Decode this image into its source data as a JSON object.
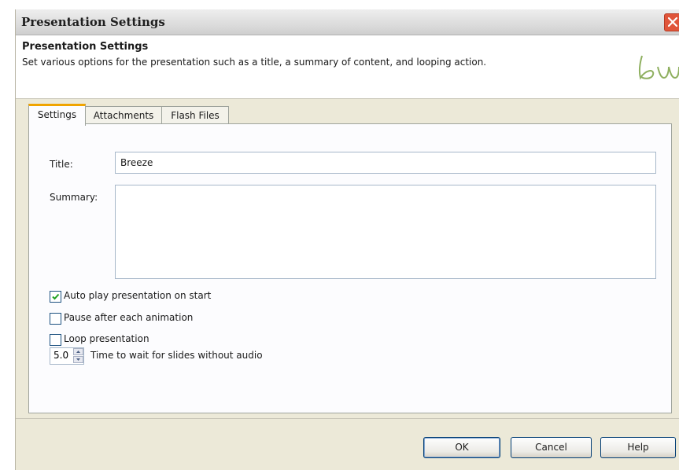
{
  "window": {
    "title": "Presentation Settings"
  },
  "header": {
    "title": "Presentation Settings",
    "subtitle": "Set various options for the presentation such as a title, a summary of content, and looping action.",
    "logo_icon": "breeze-logo-icon"
  },
  "tabs": [
    {
      "label": "Settings",
      "active": true
    },
    {
      "label": "Attachments",
      "active": false
    },
    {
      "label": "Flash Files",
      "active": false
    }
  ],
  "form": {
    "title_label": "Title:",
    "title_value": "Breeze",
    "summary_label": "Summary:",
    "summary_value": "",
    "checkboxes": [
      {
        "label": "Auto play presentation on start",
        "checked": true
      },
      {
        "label": "Pause after each animation",
        "checked": false
      },
      {
        "label": "Loop presentation",
        "checked": false
      }
    ],
    "wait_value": "5.0",
    "wait_label": "Time to wait for slides without audio"
  },
  "buttons": {
    "ok": "OK",
    "cancel": "Cancel",
    "help": "Help"
  },
  "colors": {
    "active_tab_accent": "#f0a400",
    "close_button": "#e0553a",
    "logo": "#8fb060"
  }
}
